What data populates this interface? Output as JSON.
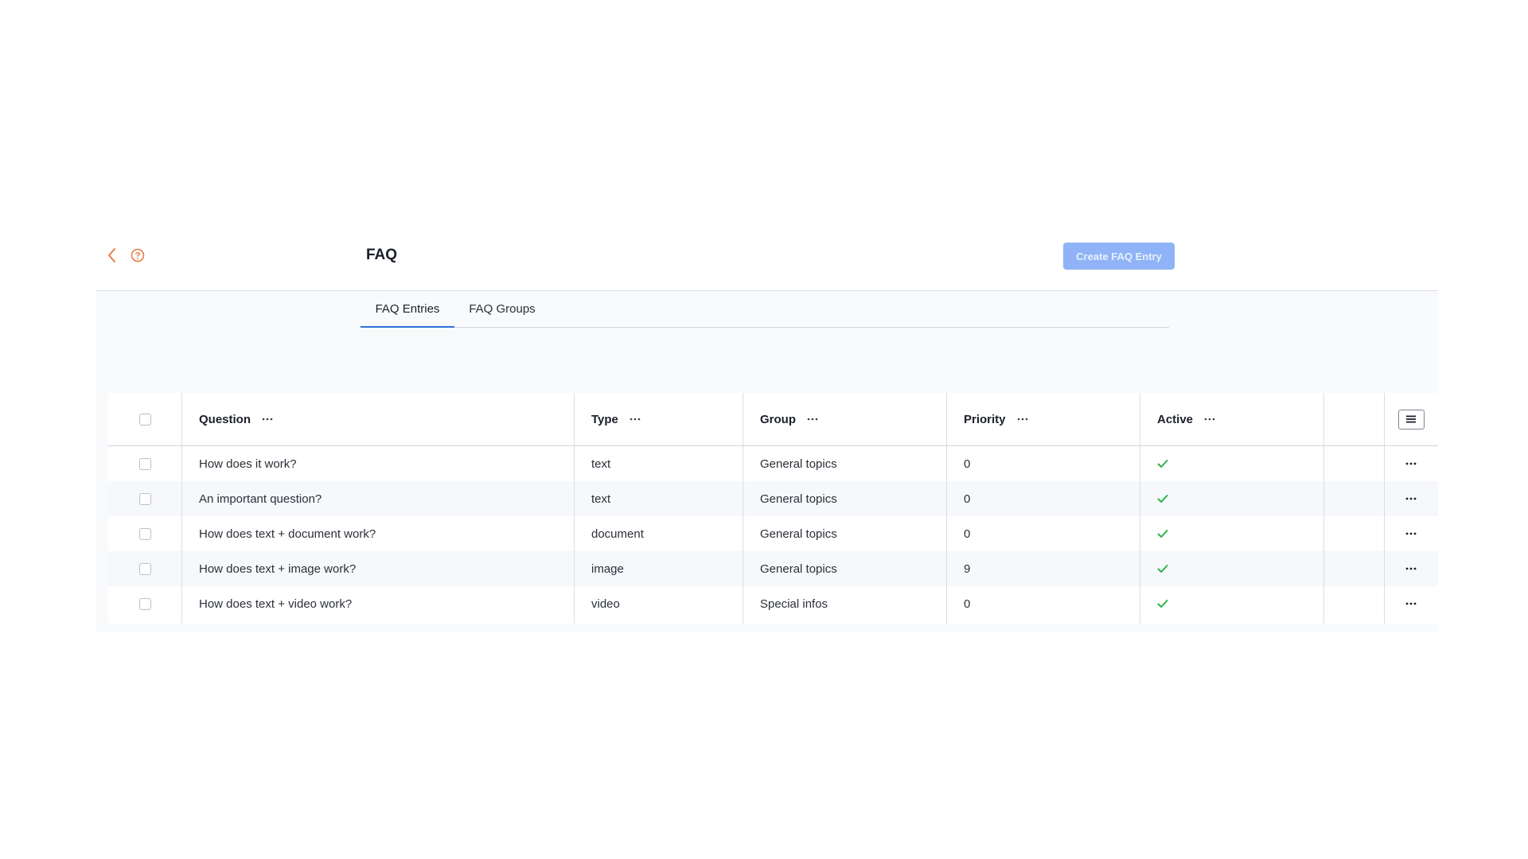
{
  "header": {
    "title": "FAQ",
    "create_button_label": "Create FAQ Entry",
    "back_icon": "chevron-left-icon",
    "help_icon": "question-circle-icon",
    "accent_color": "#e8763a",
    "primary_disabled_color": "#8fb3f6"
  },
  "tabs": [
    {
      "label": "FAQ Entries",
      "active": true
    },
    {
      "label": "FAQ Groups",
      "active": false
    }
  ],
  "table": {
    "columns": [
      {
        "label": "Question"
      },
      {
        "label": "Type"
      },
      {
        "label": "Group"
      },
      {
        "label": "Priority"
      },
      {
        "label": "Active"
      }
    ],
    "column_menu_icon": "more-horizontal-icon",
    "settings_icon": "list-settings-icon",
    "active_icon": "check-icon",
    "active_color": "#2bb34a",
    "rows": [
      {
        "question": "How does it work?",
        "type": "text",
        "group": "General topics",
        "priority": "0",
        "active": true
      },
      {
        "question": "An important question?",
        "type": "text",
        "group": "General topics",
        "priority": "0",
        "active": true
      },
      {
        "question": "How does text + document work?",
        "type": "document",
        "group": "General topics",
        "priority": "0",
        "active": true
      },
      {
        "question": "How does text + image work?",
        "type": "image",
        "group": "General topics",
        "priority": "9",
        "active": true
      },
      {
        "question": "How does text + video work?",
        "type": "video",
        "group": "Special infos",
        "priority": "0",
        "active": true
      }
    ]
  }
}
